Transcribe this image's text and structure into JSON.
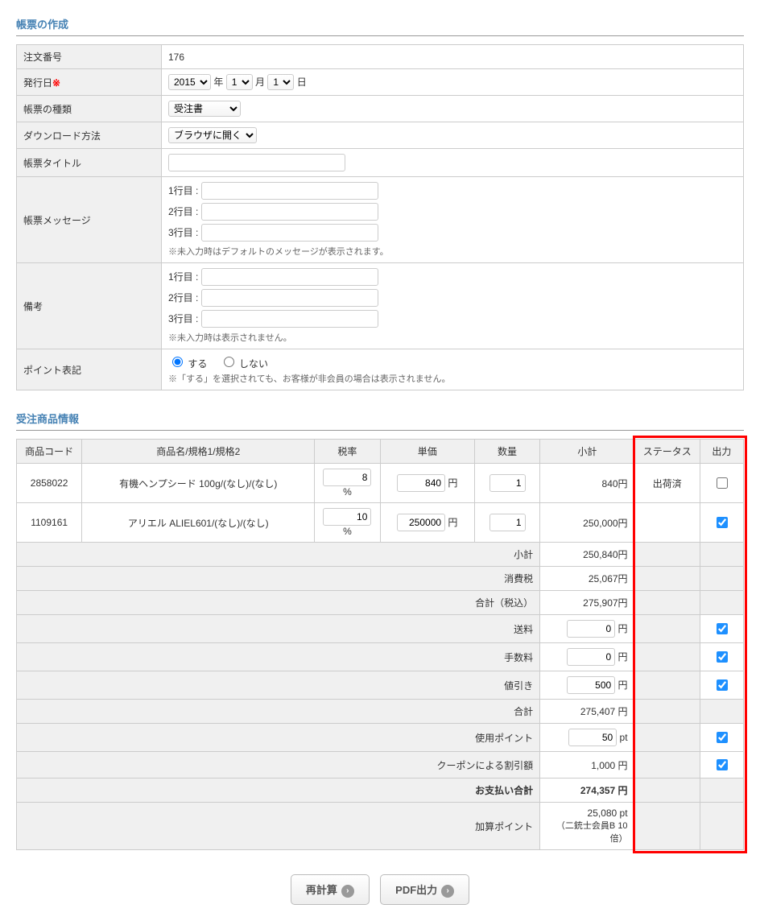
{
  "section_form_title": "帳票の作成",
  "form": {
    "order_no_label": "注文番号",
    "order_no_value": "176",
    "issue_date_label": "発行日",
    "required_mark": "※",
    "year": "2015",
    "year_sfx": "年",
    "month": "1",
    "month_sfx": "月",
    "day": "1",
    "day_sfx": "日",
    "doc_type_label": "帳票の種類",
    "doc_type_value": "受注書",
    "dl_label": "ダウンロード方法",
    "dl_value": "ブラウザに開く",
    "doc_title_label": "帳票タイトル",
    "doc_title_value": "",
    "msg_label": "帳票メッセージ",
    "line1_label": "1行目 :",
    "line2_label": "2行目 :",
    "line3_label": "3行目 :",
    "msg_note": "※未入力時はデフォルトのメッセージが表示されます。",
    "remark_label": "備考",
    "remark_note": "※未入力時は表示されません。",
    "point_label": "ポイント表記",
    "radio_do": "する",
    "radio_dont": "しない",
    "point_note": "※「する」を選択されても、お客様が非会員の場合は表示されません。"
  },
  "section_prod_title": "受注商品情報",
  "prod_headers": {
    "code": "商品コード",
    "name": "商品名/規格1/規格2",
    "tax": "税率",
    "price": "単価",
    "qty": "数量",
    "subtotal": "小計",
    "status": "ステータス",
    "output": "出力"
  },
  "products": [
    {
      "code": "2858022",
      "name": "有機ヘンプシード 100g/(なし)/(なし)",
      "tax": "8",
      "price": "840",
      "qty": "1",
      "subtotal": "840円",
      "status": "出荷済",
      "checked": false
    },
    {
      "code": "1109161",
      "name": "アリエル ALIEL601/(なし)/(なし)",
      "tax": "10",
      "price": "250000",
      "qty": "1",
      "subtotal": "250,000円",
      "status": "",
      "checked": true
    }
  ],
  "summary": {
    "subtotal_label": "小計",
    "subtotal_val": "250,840円",
    "tax_label": "消費税",
    "tax_val": "25,067円",
    "total_inc_label": "合計（税込）",
    "total_inc_val": "275,907円",
    "shipping_label": "送料",
    "shipping_val": "0",
    "shipping_unit": "円",
    "shipping_out": true,
    "fee_label": "手数料",
    "fee_val": "0",
    "fee_unit": "円",
    "fee_out": true,
    "discount_label": "値引き",
    "discount_val": "500",
    "discount_unit": "円",
    "discount_out": true,
    "total_label": "合計",
    "total_val": "275,407 円",
    "use_pt_label": "使用ポイント",
    "use_pt_val": "50",
    "use_pt_unit": "pt",
    "use_pt_out": true,
    "coupon_label": "クーポンによる割引額",
    "coupon_val": "1,000 円",
    "coupon_out": true,
    "pay_label": "お支払い合計",
    "pay_val": "274,357 円",
    "add_pt_label": "加算ポイント",
    "add_pt_val": "25,080 pt",
    "add_pt_note": "（二銃士会員B 10倍）"
  },
  "buttons": {
    "recalc": "再計算",
    "pdf": "PDF出力"
  },
  "suffix": {
    "pct": "%",
    "yen": "円"
  }
}
